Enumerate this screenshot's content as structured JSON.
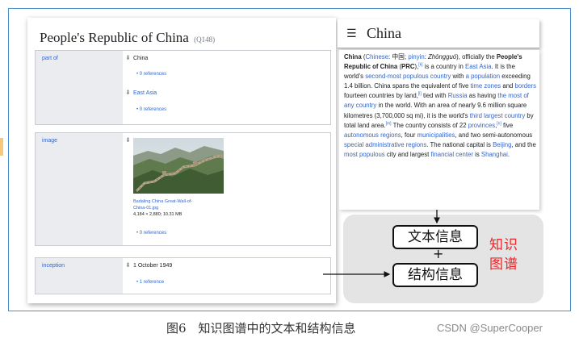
{
  "wikidata": {
    "title": "People's Republic of China",
    "qid": "(Q148)",
    "statements": [
      {
        "property": "part of",
        "values": [
          {
            "text": "China",
            "references": "• 0 references"
          },
          {
            "text": "East Asia",
            "references": "• 0 references"
          }
        ]
      },
      {
        "property": "image",
        "image": {
          "filename_line1": "Badaling China Great-Wall-of-",
          "filename_line2": "China-01.jpg",
          "dimensions": "4,184 × 2,880; 10.31 MB",
          "references": "• 0 references"
        }
      },
      {
        "property": "inception",
        "values": [
          {
            "text": "1 October 1949",
            "references": "• 1 reference"
          }
        ]
      }
    ]
  },
  "wikipedia": {
    "menu_icon": "hamburger-menu-icon",
    "title": "China",
    "paragraph": [
      {
        "t": "China",
        "s": "b"
      },
      {
        "t": " ("
      },
      {
        "t": "Chinese",
        "s": "a"
      },
      {
        "t": ": 中国; "
      },
      {
        "t": "pinyin",
        "s": "a"
      },
      {
        "t": ": "
      },
      {
        "t": "Zhōngguó",
        "s": "i"
      },
      {
        "t": "), officially the "
      },
      {
        "t": "People's Republic of China",
        "s": "b"
      },
      {
        "t": " ("
      },
      {
        "t": "PRC",
        "s": "b"
      },
      {
        "t": "),"
      },
      {
        "t": "[k]",
        "s": "sup"
      },
      {
        "t": " is a country in "
      },
      {
        "t": "East Asia",
        "s": "a"
      },
      {
        "t": ". It is the world's "
      },
      {
        "t": "second-most populous country",
        "s": "a"
      },
      {
        "t": " with "
      },
      {
        "t": "a population",
        "s": "a"
      },
      {
        "t": " exceeding 1.4 billion. China spans the equivalent of five "
      },
      {
        "t": "time zones",
        "s": "a"
      },
      {
        "t": " and "
      },
      {
        "t": "borders",
        "s": "a"
      },
      {
        "t": " fourteen countries by land,"
      },
      {
        "t": "[l]",
        "s": "sup"
      },
      {
        "t": " tied with "
      },
      {
        "t": "Russia",
        "s": "a"
      },
      {
        "t": " as having "
      },
      {
        "t": "the most of any country",
        "s": "a"
      },
      {
        "t": " in the world. With an area of nearly 9.6 million square kilometres (3,700,000 sq mi), it is the world's "
      },
      {
        "t": "third largest country",
        "s": "a"
      },
      {
        "t": " by total land area."
      },
      {
        "t": "[m]",
        "s": "sup"
      },
      {
        "t": " The country consists of 22 "
      },
      {
        "t": "provinces",
        "s": "a"
      },
      {
        "t": ","
      },
      {
        "t": "[n]",
        "s": "sup"
      },
      {
        "t": " five "
      },
      {
        "t": "autonomous regions",
        "s": "a"
      },
      {
        "t": ", four "
      },
      {
        "t": "municipalities",
        "s": "a"
      },
      {
        "t": ", and two semi-autonomous "
      },
      {
        "t": "special administrative regions",
        "s": "a"
      },
      {
        "t": ". The national capital is "
      },
      {
        "t": "Beijing",
        "s": "a"
      },
      {
        "t": ", and the "
      },
      {
        "t": "most populous",
        "s": "a"
      },
      {
        "t": " city and largest "
      },
      {
        "t": "financial center",
        "s": "a"
      },
      {
        "t": " is "
      },
      {
        "t": "Shanghai",
        "s": "a"
      },
      {
        "t": "."
      }
    ]
  },
  "diagram": {
    "text_info": "文本信息",
    "plus": "+",
    "struct_info": "结构信息",
    "kg_line1": "知识",
    "kg_line2": "图谱"
  },
  "caption": "图6　知识图谱中的文本和结构信息",
  "credit": "CSDN @SuperCooper",
  "colors": {
    "frame_border": "#4a8fd0",
    "link": "#3366cc",
    "kg_label": "#e8262a",
    "diagram_bg": "#e4e4e4"
  }
}
